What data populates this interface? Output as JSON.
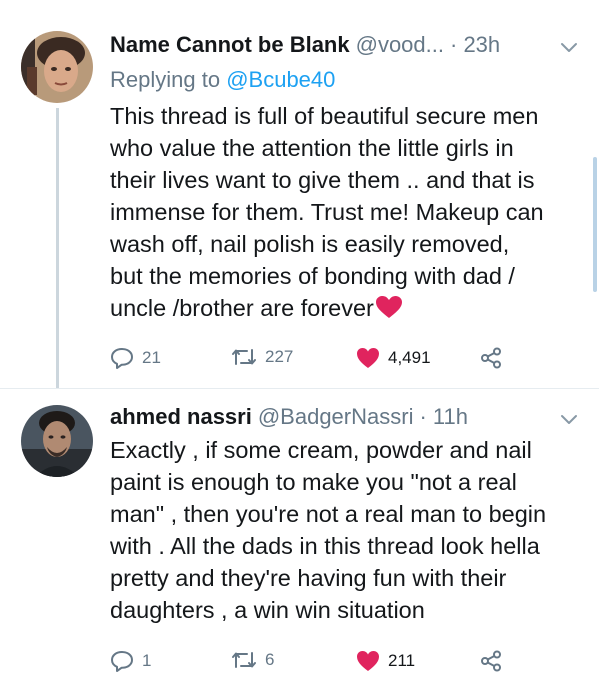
{
  "tweets": [
    {
      "name": "Name Cannot be Blank",
      "handle": "@vood...",
      "time": "· 23h",
      "reply_prefix": "Replying to",
      "reply_to": "@Bcube40",
      "lines": [
        "This thread is full of beautiful secure men",
        "who value the attention the little girls in",
        "their lives want to give them .. and that is",
        "immense for them. Trust me! Makeup can",
        "wash off, nail polish is easily removed,",
        "but the memories of bonding with dad /",
        "uncle /brother are forever"
      ],
      "replies": "21",
      "retweets": "227",
      "likes": "4,491"
    },
    {
      "name": "ahmed nassri",
      "handle": "@BadgerNassri",
      "time": "· 11h",
      "lines": [
        "Exactly , if some cream, powder and nail",
        "paint is enough to make you \"not a real",
        "man\" , then you're not a real man to begin",
        "with . All the dads in this thread look hella",
        "pretty and they're having fun with their",
        "daughters , a win win situation"
      ],
      "replies": "1",
      "retweets": "6",
      "likes": "211"
    }
  ],
  "colors": {
    "text": "#14171a",
    "secondary": "#657786",
    "link": "#1da1f2",
    "like": "#e0245e"
  },
  "icons": [
    "reply-icon",
    "retweet-icon",
    "heart-icon",
    "share-icon",
    "chevron-down-icon",
    "heart-emoji"
  ]
}
